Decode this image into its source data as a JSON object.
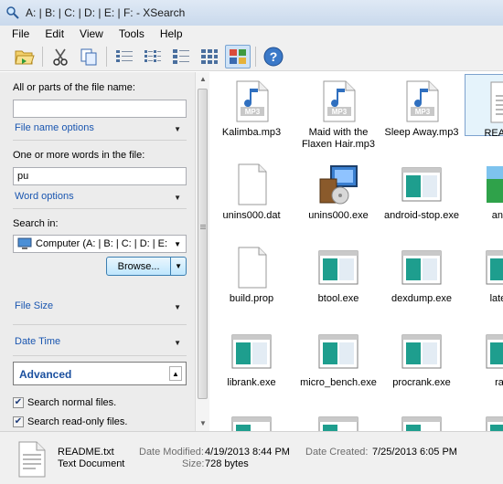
{
  "window": {
    "title": "A: | B: | C: | D: | E: | F: - XSearch"
  },
  "menu": [
    "File",
    "Edit",
    "View",
    "Tools",
    "Help"
  ],
  "toolbar": {
    "buttons": [
      "open-folder-icon",
      "cut-icon",
      "copy-icon",
      "details-view-icon",
      "list-view-icon",
      "small-icons-view-icon",
      "tiles-view-icon",
      "large-icons-view-icon",
      "help-icon"
    ],
    "active": "large-icons-view-icon"
  },
  "search": {
    "file_name_label": "All or parts of the file name:",
    "file_name_value": "",
    "file_name_options": "File name options",
    "words_label": "One or more words in the file:",
    "words_value": "pu",
    "word_options": "Word options",
    "search_in_label": "Search in:",
    "search_in_value": "Computer (A: | B: | C: | D: | E:",
    "browse_label": "Browse...",
    "file_size": "File Size",
    "date_time": "Date Time",
    "advanced": "Advanced",
    "checkboxes": [
      {
        "label": "Search normal files.",
        "checked": true
      },
      {
        "label": "Search read-only files.",
        "checked": true
      }
    ]
  },
  "results": [
    {
      "name": "Kalimba.mp3",
      "icon": "mp3-icon"
    },
    {
      "name": "Maid with the Flaxen Hair.mp3",
      "icon": "mp3-icon"
    },
    {
      "name": "Sleep Away.mp3",
      "icon": "mp3-icon"
    },
    {
      "name": "README",
      "icon": "document-icon"
    },
    {
      "name": "unins000.dat",
      "icon": "blank-file-icon"
    },
    {
      "name": "unins000.exe",
      "icon": "installer-icon"
    },
    {
      "name": "android-stop.exe",
      "icon": "exe-window-icon"
    },
    {
      "name": "androi",
      "icon": "android-icon"
    },
    {
      "name": "build.prop",
      "icon": "blank-file-icon"
    },
    {
      "name": "btool.exe",
      "icon": "exe-window-icon"
    },
    {
      "name": "dexdump.exe",
      "icon": "exe-window-icon"
    },
    {
      "name": "latency",
      "icon": "exe-window-icon"
    },
    {
      "name": "librank.exe",
      "icon": "exe-window-icon"
    },
    {
      "name": "micro_bench.exe",
      "icon": "exe-window-icon"
    },
    {
      "name": "procrank.exe",
      "icon": "exe-window-icon"
    },
    {
      "name": "rawb",
      "icon": "exe-window-icon"
    }
  ],
  "status": {
    "file_name": "README.txt",
    "file_type": "Text Document",
    "date_modified_label": "Date Modified:",
    "date_modified": "4/19/2013 8:44 PM",
    "size_label": "Size:",
    "size": "728 bytes",
    "date_created_label": "Date Created:",
    "date_created": "7/25/2013 6:05 PM"
  }
}
